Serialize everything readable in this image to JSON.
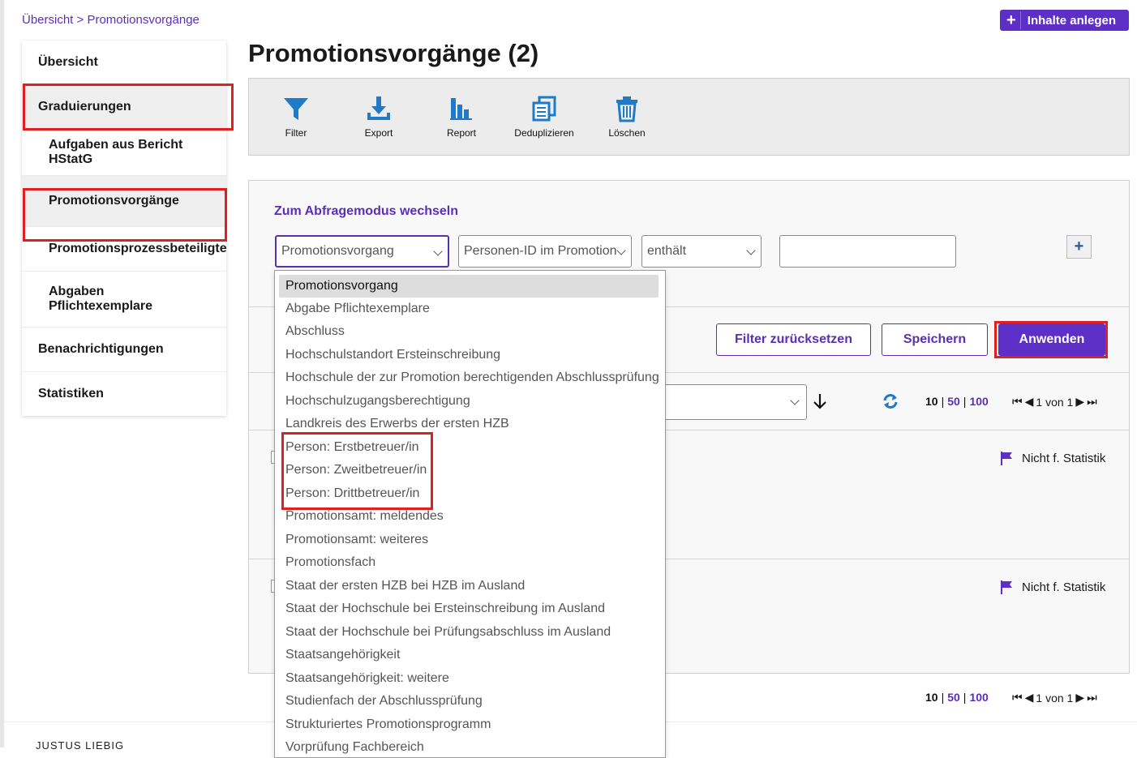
{
  "breadcrumb": {
    "root": "Übersicht",
    "separator": ">",
    "current": "Promotionsvorgänge"
  },
  "header": {
    "add_content_label": "Inhalte anlegen",
    "plus_glyph": "+"
  },
  "sidebar": {
    "items": [
      {
        "label": "Übersicht"
      },
      {
        "label": "Graduierungen"
      },
      {
        "label": "Aufgaben aus Bericht HStatG"
      },
      {
        "label": "Promotionsvorgänge"
      },
      {
        "label": "Promotionsprozessbeteiligte"
      },
      {
        "label": "Abgaben Pflichtexemplare"
      },
      {
        "label": "Benachrichtigungen"
      },
      {
        "label": "Statistiken"
      }
    ]
  },
  "page_title": "Promotionsvorgänge (2)",
  "toolbar": {
    "filter": "Filter",
    "export": "Export",
    "report": "Report",
    "dedupe": "Deduplizieren",
    "delete": "Löschen"
  },
  "filter": {
    "switch_mode_label": "Zum Abfragemodus wechseln",
    "entity_value": "Promotionsvorgang",
    "field_value": "Personen-ID im Promotion",
    "operator_value": "enthält",
    "search_value": "",
    "add_row_glyph": "+",
    "reset_label": "Filter zurücksetzen",
    "save_label": "Speichern",
    "apply_label": "Anwenden"
  },
  "list": {
    "page_sizes": [
      "10",
      "50",
      "100"
    ],
    "page_info": "1 von 1",
    "row_status_1": "Nicht f. Statistik",
    "row_status_2": "Nicht f. Statistik"
  },
  "dropdown": {
    "options": [
      "Promotionsvorgang",
      "Abgabe Pflichtexemplare",
      "Abschluss",
      "Hochschulstandort Ersteinschreibung",
      "Hochschule der zur Promotion berechtigenden Abschlussprüfung",
      "Hochschulzugangsberechtigung",
      "Landkreis des Erwerbs der ersten HZB",
      "Person: Erstbetreuer/in",
      "Person: Zweitbetreuer/in",
      "Person: Drittbetreuer/in",
      "Promotionsamt: meldendes",
      "Promotionsamt: weiteres",
      "Promotionsfach",
      "Staat der ersten HZB bei HZB im Ausland",
      "Staat der Hochschule bei Ersteinschreibung im Ausland",
      "Staat der Hochschule bei Prüfungsabschluss im Ausland",
      "Staatsangehörigkeit",
      "Staatsangehörigkeit: weitere",
      "Studienfach der Abschlussprüfung",
      "Strukturiertes Promotionsprogramm",
      "Vorprüfung Fachbereich"
    ],
    "selected_index": 0
  },
  "footer": {
    "text": "JUSTUS LIEBIG"
  },
  "colors": {
    "accent": "#5d2fc7",
    "highlight": "#e02020",
    "toolbar_icon": "#1f7ac8"
  }
}
